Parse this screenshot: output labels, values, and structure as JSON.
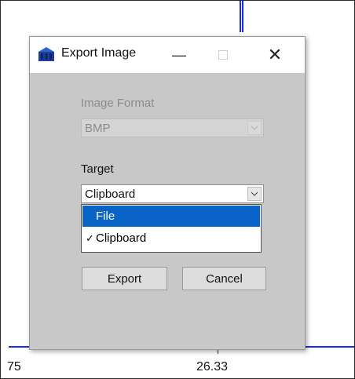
{
  "window": {
    "title": "Export Image",
    "minimize_glyph": "—",
    "close_glyph": "✕"
  },
  "form": {
    "image_format_label": "Image Format",
    "image_format_value": "BMP",
    "target_label": "Target",
    "target_value": "Clipboard"
  },
  "dropdown": {
    "options": [
      {
        "label": "File",
        "checked": false,
        "highlighted": true
      },
      {
        "label": "Clipboard",
        "checked": true,
        "highlighted": false
      }
    ],
    "check_glyph": "✓"
  },
  "buttons": {
    "export_label": "Export",
    "cancel_label": "Cancel"
  },
  "plot": {
    "tick_left_label": "75",
    "tick_mid_label": "26.33",
    "line_color": "#1a2de0"
  },
  "icons": {
    "app": "app-icon",
    "dropdown_arrow": "chevron-down-icon"
  }
}
